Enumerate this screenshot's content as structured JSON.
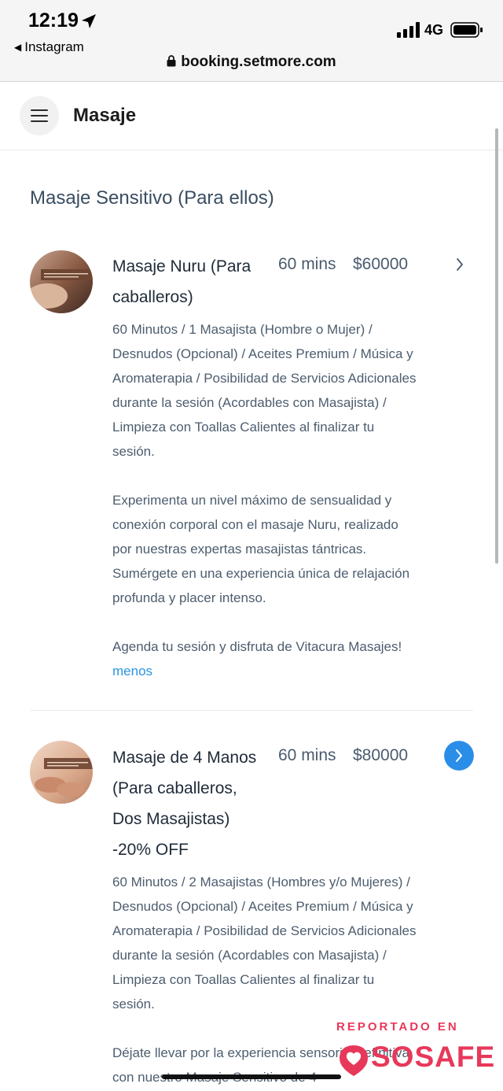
{
  "status_bar": {
    "time": "12:19",
    "back_app": "Instagram",
    "network": "4G"
  },
  "browser": {
    "url": "booking.setmore.com"
  },
  "header": {
    "title": "Masaje"
  },
  "category": {
    "title": "Masaje Sensitivo (Para ellos)"
  },
  "services": [
    {
      "name": "Masaje Nuru (Para caballeros)",
      "duration": "60 mins",
      "price": "$60000",
      "paragraphs": [
        "60 Minutos / 1 Masajista (Hombre o Mujer) / Desnudos (Opcional) / Aceites Premium / Música y Aromaterapia / Posibilidad de Servicios Adicionales durante la sesión (Acordables con Masajista) / Limpieza con Toallas Calientes al finalizar tu sesión.",
        "Experimenta un nivel máximo de sensualidad y conexión corporal con el masaje Nuru, realizado por nuestras expertas masajistas tántricas. Sumérgete en una experiencia única de relajación profunda y placer intenso.",
        "Agenda tu sesión y disfruta de Vitacura Masajes!"
      ],
      "less_link": "menos"
    },
    {
      "name": "Masaje de 4 Manos (Para caballeros, Dos Masajistas) -20% OFF",
      "duration": "60 mins",
      "price": "$80000",
      "paragraphs": [
        "60 Minutos / 2 Masajistas (Hombres y/o Mujeres) / Desnudos (Opcional) / Aceites Premium / Música y Aromaterapia / Posibilidad de Servicios Adicionales durante la sesión (Acordables con Masajista) / Limpieza con Toallas Calientes al finalizar tu sesión.",
        "Déjate llevar por la experiencia sensorial definitiva con nuestro Masaje Sensitivo de 4"
      ]
    }
  ],
  "watermark": {
    "top": "REPORTADO EN",
    "brand": "SOSAFE"
  },
  "colors": {
    "accent": "#2a95e0",
    "watermark": "#e8385a"
  }
}
